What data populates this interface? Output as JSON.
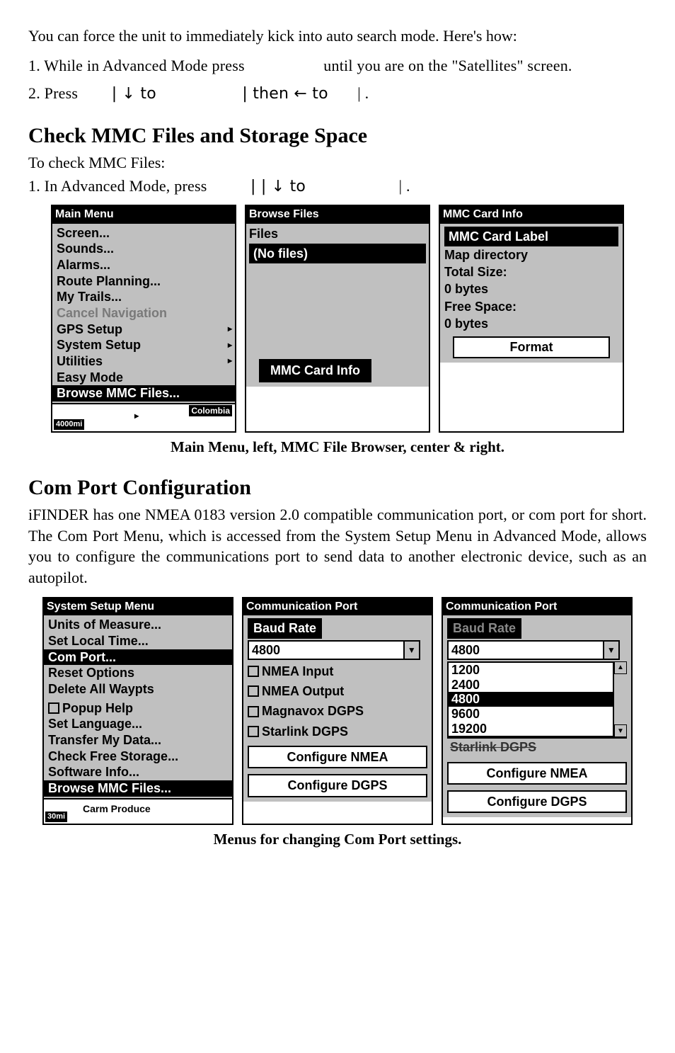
{
  "intro": "You can force the unit to immediately kick into auto search mode. Here's how:",
  "step1": "1. While in Advanced Mode press",
  "step1_tail": "until you are on the \"Satellites\" screen.",
  "step2_press": "2. Press",
  "step2_to1": "| ↓ to",
  "step2_then": "|       then ← to",
  "step2_end": "|      .",
  "heading_mmc": "Check MMC Files and Storage Space",
  "mmc_intro": "To check MMC Files:",
  "mmc_step1": "1. In Advanced Mode, press",
  "mmc_mid": "|       | ↓ to",
  "mmc_end": "|     .",
  "fig1_caption": "Main Menu, left, MMC File Browser, center & right.",
  "heading_com": "Com Port Configuration",
  "com_para": "iFINDER has one NMEA 0183 version 2.0 compatible communication port, or com port for short. The Com Port Menu, which is accessed from the System Setup Menu in Advanced Mode, allows you to configure the communications port to send data to another electronic device, such as an autopilot.",
  "fig2_caption": "Menus for changing Com Port settings.",
  "main_menu": {
    "title": "Main Menu",
    "items": [
      "Screen...",
      "Sounds...",
      "Alarms...",
      "Route Planning...",
      "My Trails...",
      "Cancel Navigation",
      "GPS Setup",
      "System Setup",
      "Utilities",
      "Easy Mode",
      "Browse MMC Files..."
    ],
    "map_label": "Colombia",
    "scale": "4000mi"
  },
  "browse": {
    "title": "Browse Files",
    "header2": "Files",
    "nofiles": "(No files)",
    "button": "MMC Card Info"
  },
  "mmc": {
    "title": "MMC Card Info",
    "label": "MMC Card Label",
    "dir": "Map directory",
    "total": "Total Size:",
    "total_v": "0 bytes",
    "free": "Free Space:",
    "free_v": "0 bytes",
    "format": "Format"
  },
  "sys_menu": {
    "title": "System Setup Menu",
    "items": [
      "Units of Measure...",
      "Set Local Time...",
      "Com Port...",
      "Reset Options",
      "Delete All Waypts",
      "Popup Help",
      "Set Language...",
      "Transfer My Data...",
      "Check Free Storage...",
      "Software Info...",
      "Browse MMC Files..."
    ],
    "map_label": "Carm Produce",
    "scale": "30mi"
  },
  "com1": {
    "title": "Communication Port",
    "baud_label": "Baud Rate",
    "baud": "4800",
    "opts": [
      "NMEA Input",
      "NMEA Output",
      "Magnavox DGPS",
      "Starlink DGPS"
    ],
    "btn1": "Configure NMEA",
    "btn2": "Configure DGPS"
  },
  "com2": {
    "title": "Communication Port",
    "baud_label": "Baud Rate",
    "baud": "4800",
    "list": [
      "1200",
      "2400",
      "4800",
      "9600",
      "19200"
    ],
    "partial": "Starlink DGPS",
    "btn1": "Configure NMEA",
    "btn2": "Configure DGPS"
  }
}
